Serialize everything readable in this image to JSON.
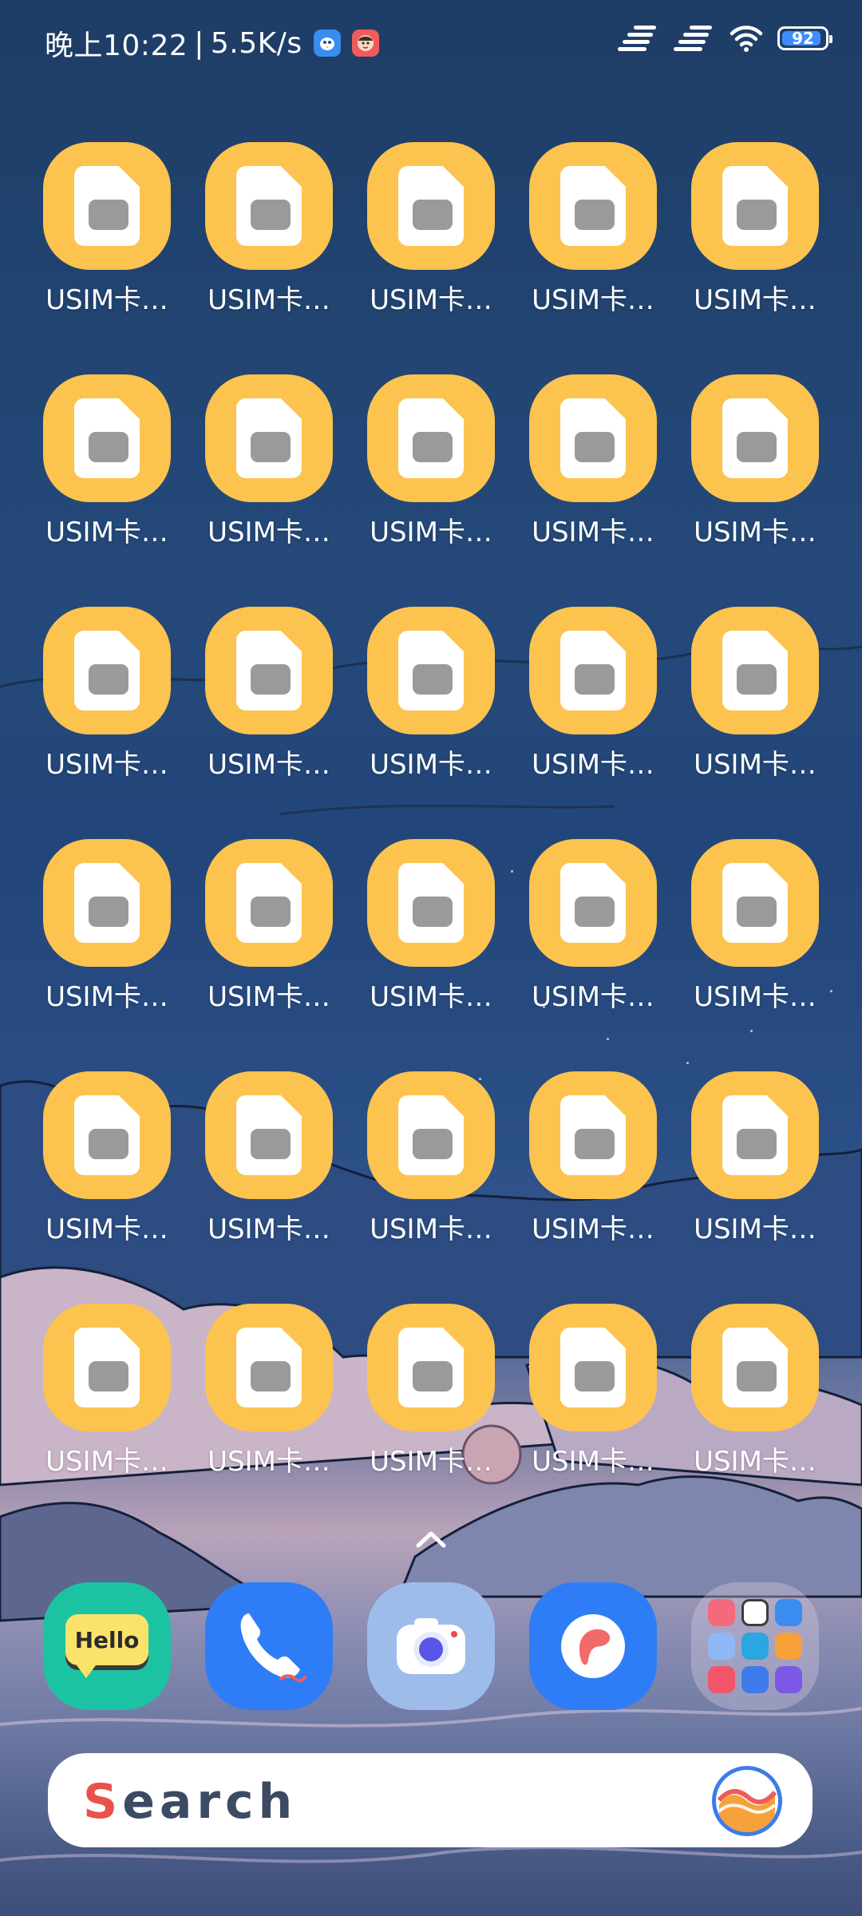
{
  "status_bar": {
    "time": "晚上10:22",
    "separator": "|",
    "network_speed": "5.5K/s",
    "battery_level": "92",
    "battery_fraction": 0.92,
    "icons": [
      "bird-notification-icon",
      "avatar-notification-icon",
      "signal-1-icon",
      "signal-2-icon",
      "wifi-icon",
      "battery-icon"
    ]
  },
  "apps": [
    {
      "label": "USIM卡…"
    },
    {
      "label": "USIM卡…"
    },
    {
      "label": "USIM卡…"
    },
    {
      "label": "USIM卡…"
    },
    {
      "label": "USIM卡…"
    },
    {
      "label": "USIM卡…"
    },
    {
      "label": "USIM卡…"
    },
    {
      "label": "USIM卡…"
    },
    {
      "label": "USIM卡…"
    },
    {
      "label": "USIM卡…"
    },
    {
      "label": "USIM卡…"
    },
    {
      "label": "USIM卡…"
    },
    {
      "label": "USIM卡…"
    },
    {
      "label": "USIM卡…"
    },
    {
      "label": "USIM卡…"
    },
    {
      "label": "USIM卡…"
    },
    {
      "label": "USIM卡…"
    },
    {
      "label": "USIM卡…"
    },
    {
      "label": "USIM卡…"
    },
    {
      "label": "USIM卡…"
    },
    {
      "label": "USIM卡…"
    },
    {
      "label": "USIM卡…"
    },
    {
      "label": "USIM卡…"
    },
    {
      "label": "USIM卡…"
    },
    {
      "label": "USIM卡…"
    },
    {
      "label": "USIM卡…"
    },
    {
      "label": "USIM卡…"
    },
    {
      "label": "USIM卡…"
    },
    {
      "label": "USIM卡…"
    },
    {
      "label": "USIM卡…"
    }
  ],
  "app_icon": "sim-card-icon",
  "page_indicator_icon": "chevron-up-icon",
  "dock": {
    "hello_app": {
      "label": "Hello",
      "icon": "hello-speech-bubble-icon"
    },
    "phone_app": {
      "icon": "phone-icon"
    },
    "camera_app": {
      "icon": "camera-icon"
    },
    "browser_app": {
      "icon": "browser-icon"
    },
    "folder": {
      "icon": "folder-icon"
    }
  },
  "search": {
    "label_first": "S",
    "label_rest": "earch",
    "assistant_icon": "assistant-icon"
  },
  "colors": {
    "app_icon_bg": "#fdc34f",
    "sim_chip": "#9a9a9a",
    "hello_bg": "#1cc3a3",
    "phone_bg": "#2f7df6",
    "camera_bg": "#9dbcea",
    "browser_bg": "#2f7df6",
    "search_accent": "#e9524a"
  }
}
